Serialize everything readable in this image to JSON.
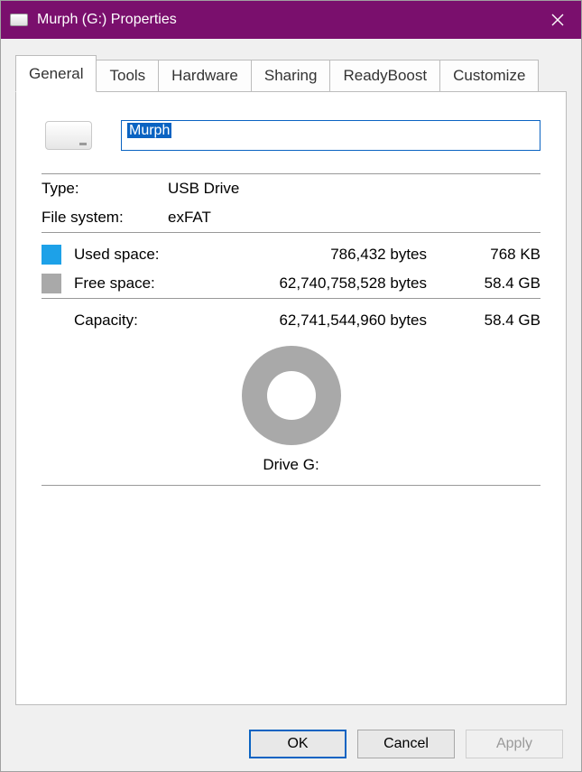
{
  "window": {
    "title": "Murph (G:) Properties"
  },
  "tabs": [
    {
      "label": "General",
      "active": true
    },
    {
      "label": "Tools",
      "active": false
    },
    {
      "label": "Hardware",
      "active": false
    },
    {
      "label": "Sharing",
      "active": false
    },
    {
      "label": "ReadyBoost",
      "active": false
    },
    {
      "label": "Customize",
      "active": false
    }
  ],
  "general": {
    "volume_name": "Murph",
    "type_label": "Type:",
    "type_value": "USB Drive",
    "fs_label": "File system:",
    "fs_value": "exFAT",
    "used_label": "Used space:",
    "used_bytes": "786,432 bytes",
    "used_human": "768 KB",
    "free_label": "Free space:",
    "free_bytes": "62,740,758,528 bytes",
    "free_human": "58.4 GB",
    "capacity_label": "Capacity:",
    "capacity_bytes": "62,741,544,960 bytes",
    "capacity_human": "58.4 GB",
    "drive_caption": "Drive G:",
    "colors": {
      "used": "#1da1e8",
      "free": "#a9a9a9"
    }
  },
  "buttons": {
    "ok": "OK",
    "cancel": "Cancel",
    "apply": "Apply"
  },
  "chart_data": {
    "type": "pie",
    "title": "Drive G:",
    "series": [
      {
        "name": "Used space",
        "value_bytes": 786432,
        "value_human": "768 KB",
        "color": "#1da1e8"
      },
      {
        "name": "Free space",
        "value_bytes": 62740758528,
        "value_human": "58.4 GB",
        "color": "#a9a9a9"
      }
    ],
    "total_bytes": 62741544960,
    "total_human": "58.4 GB"
  }
}
